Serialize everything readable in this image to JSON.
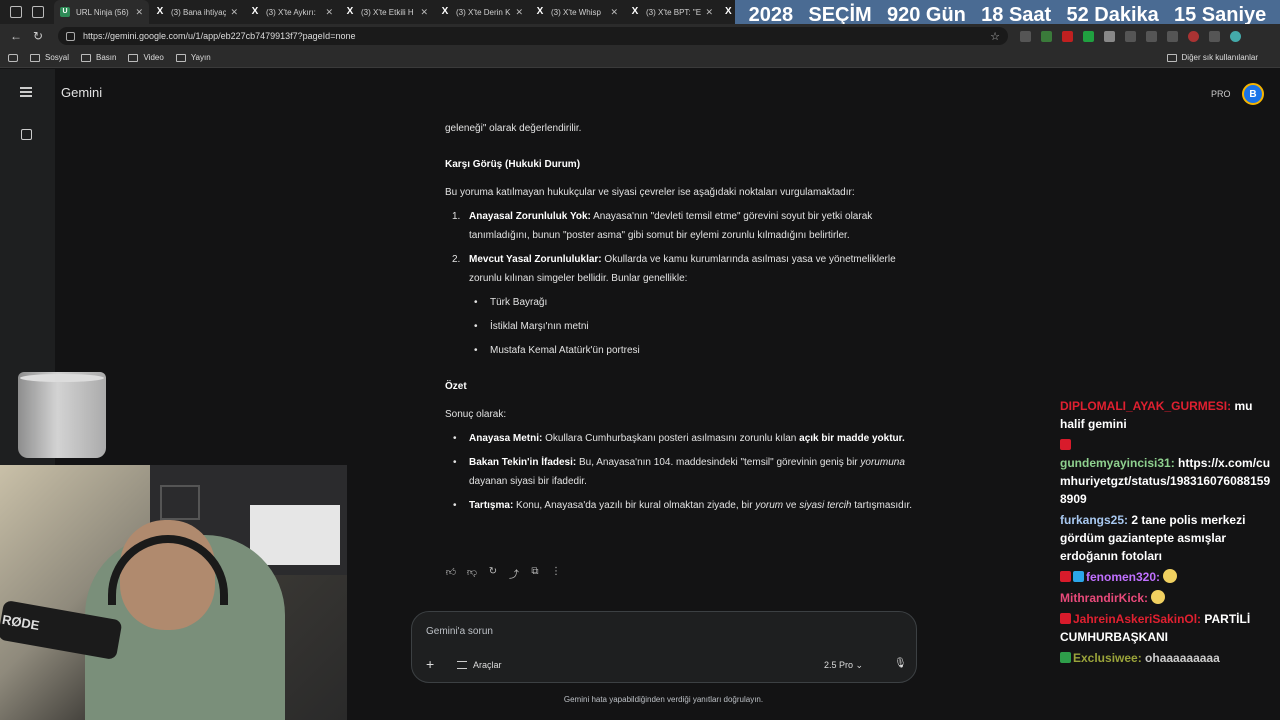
{
  "browser": {
    "tabs": [
      {
        "label": "URL Ninja (56)",
        "icon": "url-ninja-icon"
      },
      {
        "label": "(3) Bana ihtiyaç",
        "icon": "x-icon"
      },
      {
        "label": "(3) X'te Aykırı:",
        "icon": "x-icon"
      },
      {
        "label": "(3) X'te Etkili H",
        "icon": "x-icon"
      },
      {
        "label": "(3) X'te Derin K",
        "icon": "x-icon"
      },
      {
        "label": "(3) X'te Whisp",
        "icon": "x-icon"
      },
      {
        "label": "(3) X'te BPT: \"E",
        "icon": "x-icon"
      }
    ],
    "url": "https://gemini.google.com/u/1/app/eb227cb7479913f7?pageId=none",
    "bookmarks": [
      "Sosyal",
      "Basın",
      "Video",
      "Yayın"
    ],
    "other_bookmarks": "Diğer sık kullanılanlar"
  },
  "countdown": [
    "2028",
    "SEÇİM",
    "920 Gün",
    "18 Saat",
    "52 Dakika",
    "15 Saniye"
  ],
  "gemini": {
    "brand": "Gemini",
    "pro_label": "PRO",
    "avatar_letter": "B",
    "content": {
      "intro_tail": "geleneği\" olarak değerlendirilir.",
      "section_heading": "Karşı Görüş (Hukuki Durum)",
      "section_intro": "Bu yoruma katılmayan hukukçular ve siyasi çevreler ise aşağıdaki noktaları vurgulamaktadır:",
      "numbered": [
        {
          "num": "1.",
          "bold": "Anayasal Zorunluluk Yok:",
          "text": " Anayasa'nın \"devleti temsil etme\" görevini soyut bir yetki olarak tanımladığını, bunun \"poster asma\" gibi somut bir eylemi zorunlu kılmadığını belirtirler."
        },
        {
          "num": "2.",
          "bold": "Mevcut Yasal Zorunluluklar:",
          "text": " Okullarda ve kamu kurumlarında asılması yasa ve yönetmeliklerle zorunlu kılınan simgeler bellidir. Bunlar genellikle:"
        }
      ],
      "sub_bullets": [
        "Türk Bayrağı",
        "İstiklal Marşı'nın metni",
        "Mustafa Kemal Atatürk'ün portresi"
      ],
      "summary_heading": "Özet",
      "summary_intro": "Sonuç olarak:",
      "summary": [
        {
          "bold": "Anayasa Metni:",
          "text": " Okullara Cumhurbaşkanı posteri asılmasını zorunlu kılan ",
          "bold2": "açık bir madde yoktur."
        },
        {
          "bold": "Bakan Tekin'in İfadesi:",
          "text": " Bu, Anayasa'nın 104. maddesindeki \"temsil\" görevinin geniş bir ",
          "italic": "yorumuna",
          "text2": " dayanan siyasi bir ifadedir."
        },
        {
          "bold": "Tartışma:",
          "text": " Konu, Anayasa'da yazılı bir kural olmaktan ziyade, bir ",
          "italic": "yorum",
          "text2": " ve ",
          "italic2": "siyasi tercih",
          "text3": " tartışmasıdır."
        }
      ]
    },
    "input": {
      "placeholder": "Gemini'a sorun",
      "tools_label": "Araçlar",
      "model_label": "2.5 Pro"
    },
    "disclaimer": "Gemini hata yapabildiğinden verdiği yanıtları doğrulayın."
  },
  "webcam": {
    "mic_brand": "RØDE"
  },
  "chat": [
    {
      "user": "DIPLOMALI_AYAK_GURMESI:",
      "color": "#e02030",
      "msg": " mu halif gemini"
    },
    {
      "user": "gundemyayincisi31:",
      "color": "#8fd18f",
      "msg": " https://x.com/cumhuriyetgzt/status/1983160760881598909"
    },
    {
      "user": "furkangs25:",
      "color": "#a8c8f0",
      "msg": " 2 tane polis merkezi gördüm gaziantepte asmışlar erdoğanın fotoları"
    },
    {
      "user": "fenomen320:",
      "color": "#c070ff",
      "msg": ""
    },
    {
      "user": "MithrandirKick:",
      "color": "#e84a7a",
      "msg": ""
    },
    {
      "user": "JahreinAskeriSakinOl:",
      "color": "#e02030",
      "msg": " PARTİLİ CUMHURBAŞKANI"
    },
    {
      "user": "Exclusiwee:",
      "color": "#9aa33a",
      "msg": " ohaaaaaaaaa"
    }
  ]
}
